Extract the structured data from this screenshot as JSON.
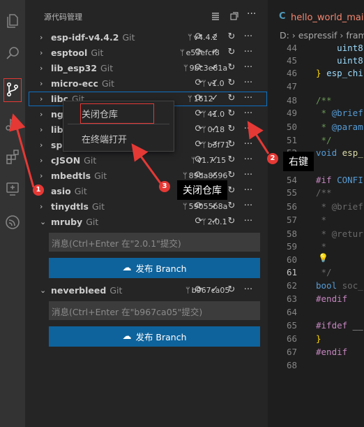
{
  "sidebar": {
    "title": "源代码管理",
    "repos": [
      {
        "name": "esp-idf-v4.4.2",
        "git": "Git",
        "branch": "v4.4.2",
        "expanded": false
      },
      {
        "name": "esptool",
        "git": "Git",
        "branch": "e53efcf8",
        "expanded": false
      },
      {
        "name": "lib_esp32",
        "git": "Git",
        "branch": "9bc3e81a",
        "expanded": false
      },
      {
        "name": "micro-ecc",
        "git": "Git",
        "branch": "v1.0",
        "expanded": false
      },
      {
        "name": "libc",
        "git": "Git",
        "branch": "1612",
        "expanded": false
      },
      {
        "name": "ngl",
        "git": "Git",
        "branch": "41.0",
        "expanded": false
      },
      {
        "name": "libs",
        "git": "Git",
        "branch": "0.18",
        "expanded": false
      },
      {
        "name": "spi",
        "git": "Git",
        "branch": "b3f71",
        "expanded": false
      },
      {
        "name": "cJSON",
        "git": "Git",
        "branch": "v1.7.15",
        "expanded": false
      },
      {
        "name": "mbedtls",
        "git": "Git",
        "branch": "89da8596",
        "expanded": false
      },
      {
        "name": "asio",
        "git": "Git",
        "branch": "f9",
        "expanded": false
      },
      {
        "name": "tinydtls",
        "git": "Git",
        "branch": "59055b8a",
        "expanded": false
      },
      {
        "name": "mruby",
        "git": "Git",
        "branch": "2.0.1",
        "expanded": true
      },
      {
        "name": "neverbleed",
        "git": "Git",
        "branch": "b967ca05",
        "expanded": true
      }
    ],
    "mruby_message_placeholder": "消息(Ctrl+Enter 在\"2.0.1\"提交)",
    "neverbleed_message_placeholder": "消息(Ctrl+Enter 在\"b967ca05\"提交)",
    "publish_label": "发布 Branch"
  },
  "context_menu": {
    "items": [
      "关闭仓库",
      "在终端打开"
    ]
  },
  "editor": {
    "tab_title": "hello_world_main.c",
    "tab_icon": "C",
    "breadcrumb": "D: › espressif › frame",
    "line_numbers": [
      "44",
      "45",
      "46",
      "47",
      "48",
      "49",
      "50",
      "51",
      "52",
      "53",
      "54",
      "55",
      "56",
      "57",
      "58",
      "59",
      "60",
      "61",
      "62",
      "63",
      "64",
      "65",
      "66",
      "67",
      "68"
    ],
    "current_line": "61"
  },
  "annotations": {
    "step1": "1",
    "step2": "2",
    "step3": "3",
    "label2": "右键",
    "label3": "关闭仓库"
  },
  "colors": {
    "accent": "#0e639c",
    "annotation_red": "#e53935",
    "error_tab": "#f48771"
  }
}
